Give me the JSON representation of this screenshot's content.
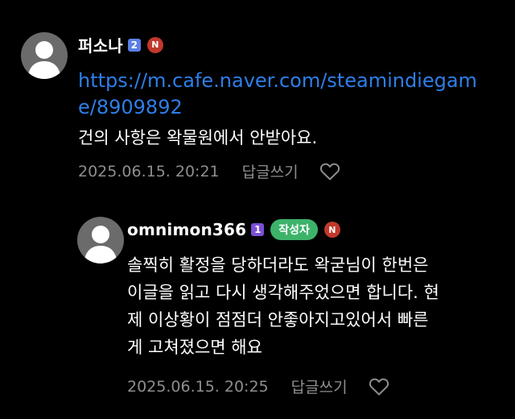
{
  "colors": {
    "background": "#000000",
    "text": "#ffffff",
    "muted": "#8e8e8e",
    "link": "#2e7ee8",
    "level_badge": "#5a7fe6",
    "n_badge": "#c0392b",
    "writer_badge": "#3db36a",
    "avatar_bg": "#6b6b6b"
  },
  "comments": [
    {
      "author": "퍼소나",
      "level_badge": "2",
      "new_badge": "N",
      "link": "https://m.cafe.naver.com/steamindiegame/8909892",
      "text": "건의 사항은 왁물원에서 안받아요.",
      "timestamp": "2025.06.15. 20:21",
      "reply_label": "답글쓰기",
      "like_icon": "heart-outline-icon"
    },
    {
      "author": "omnimon366",
      "level_badge": "1",
      "writer_badge": "작성자",
      "new_badge": "N",
      "text_lines": [
        "솔찍히 활정을 당하더라도 왁굳님이 한번은",
        "이글을 읽고 다시 생각해주었으면 합니다. 현",
        "제 이상황이 점점더 안좋아지고있어서 빠른",
        "게 고쳐졌으면 해요"
      ],
      "timestamp": "2025.06.15. 20:25",
      "reply_label": "답글쓰기",
      "like_icon": "heart-outline-icon"
    }
  ]
}
